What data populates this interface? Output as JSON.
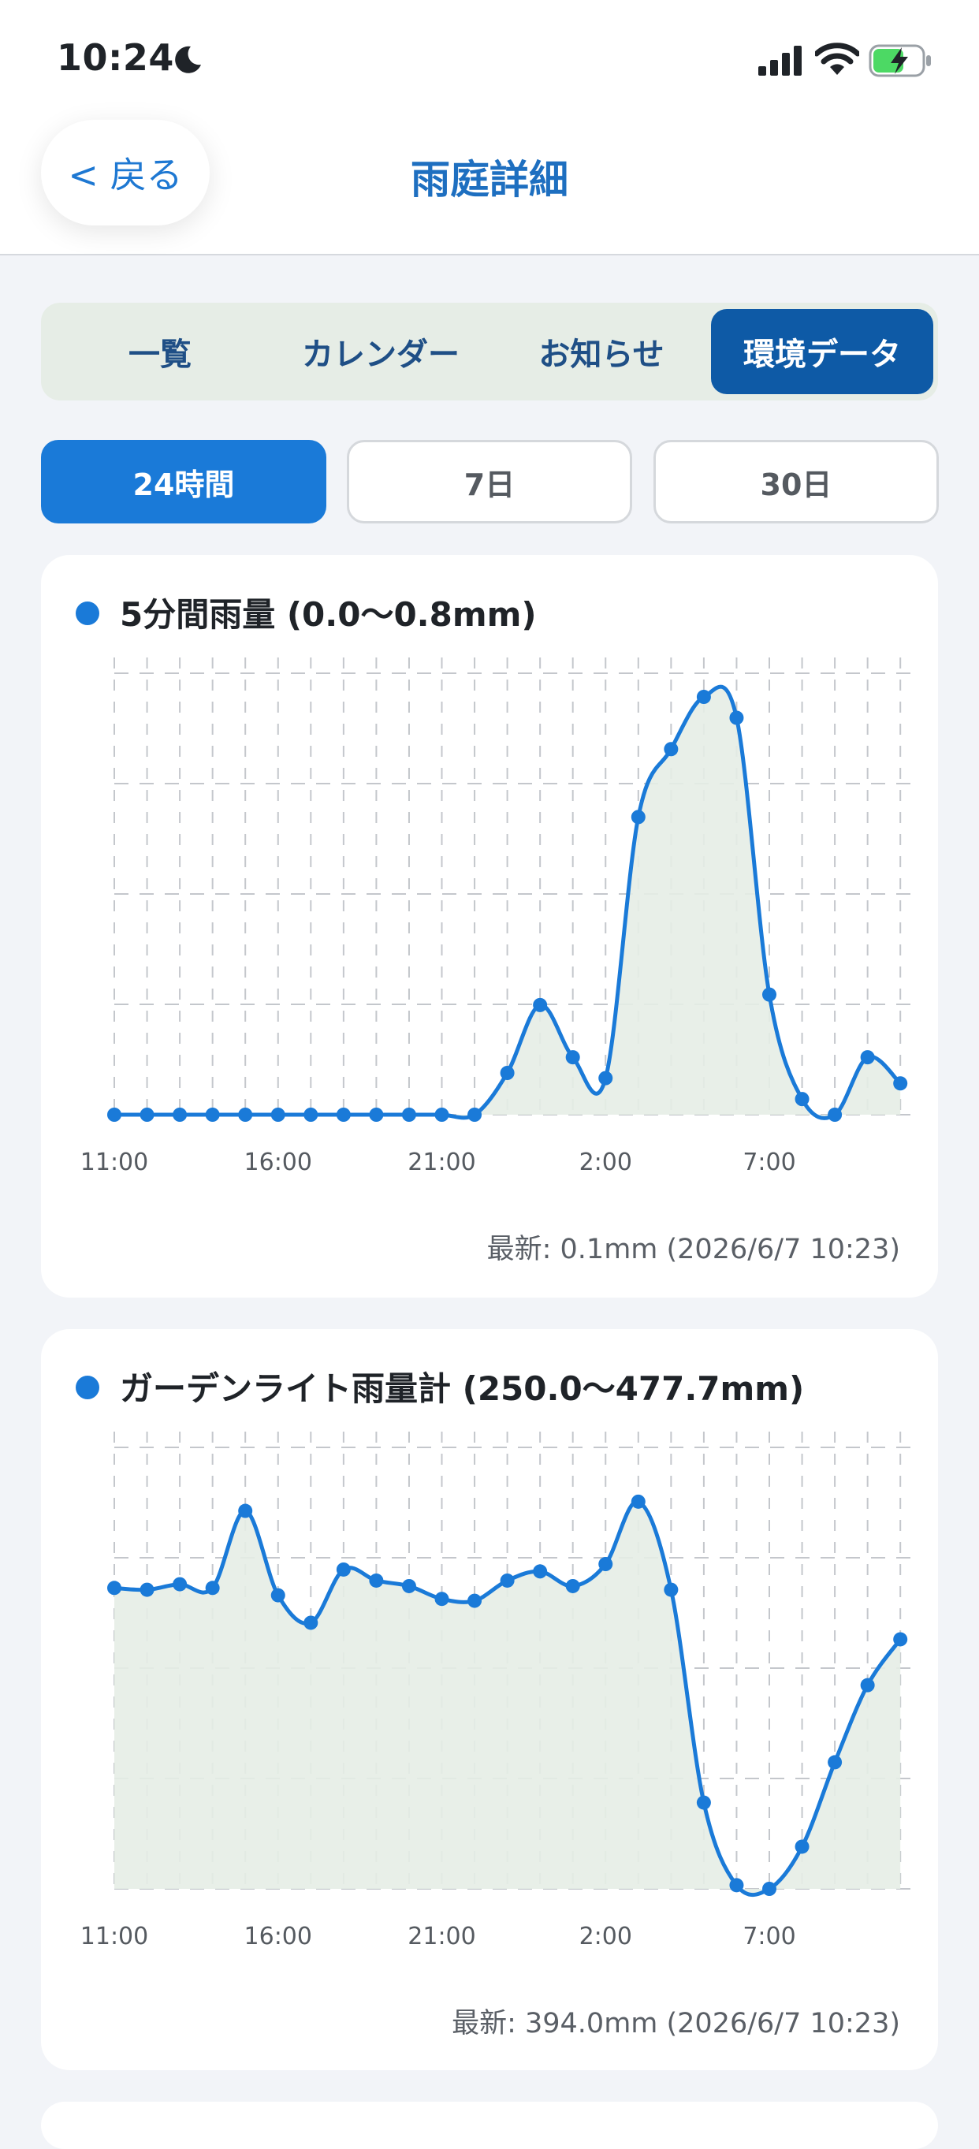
{
  "status_bar": {
    "time": "10:24"
  },
  "header": {
    "back_label": "< 戻る",
    "title": "雨庭詳細"
  },
  "tabs": [
    {
      "label": "一覧",
      "active": false
    },
    {
      "label": "カレンダー",
      "active": false
    },
    {
      "label": "お知らせ",
      "active": false
    },
    {
      "label": "環境データ",
      "active": true
    }
  ],
  "ranges": [
    {
      "label": "24時間",
      "active": true
    },
    {
      "label": "7日",
      "active": false
    },
    {
      "label": "30日",
      "active": false
    }
  ],
  "cards": [
    {
      "title": "5分間雨量 (0.0〜0.8mm)",
      "latest": "最新: 0.1mm (2026/6/7 10:23)"
    },
    {
      "title": "ガーデンライト雨量計 (250.0〜477.7mm)",
      "latest": "最新: 394.0mm (2026/6/7 10:23)"
    }
  ],
  "colors": {
    "accent": "#1a7ad8",
    "tab_active": "#0e5aa6",
    "fill": "#e6ede6"
  },
  "chart_data": [
    {
      "type": "area",
      "title": "5分間雨量 (0.0〜0.8mm)",
      "x_ticks": [
        "11:00",
        "16:00",
        "21:00",
        "2:00",
        "7:00"
      ],
      "ylim": [
        0,
        0.8
      ],
      "grid": true,
      "series": [
        {
          "values": [
            0,
            0,
            0,
            0,
            0,
            0,
            0,
            0,
            0,
            0,
            0,
            0,
            0.08,
            0.21,
            0.11,
            0.07,
            0.57,
            0.7,
            0.8,
            0.76,
            0.23,
            0.03,
            0,
            0.11,
            0.06
          ]
        }
      ]
    },
    {
      "type": "area",
      "title": "ガーデンライト雨量計 (250.0〜477.7mm)",
      "x_ticks": [
        "11:00",
        "16:00",
        "21:00",
        "2:00",
        "7:00"
      ],
      "ylim": [
        250.0,
        477.7
      ],
      "grid": true,
      "series": [
        {
          "values": [
            414,
            413,
            416,
            414,
            456,
            410,
            395,
            424,
            418,
            415,
            408,
            407,
            418,
            423,
            415,
            427,
            461,
            413,
            297,
            252,
            250,
            273,
            319,
            361,
            386
          ]
        }
      ]
    }
  ]
}
